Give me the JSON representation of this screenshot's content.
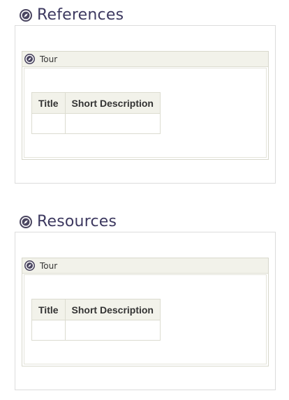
{
  "sections": [
    {
      "title": "References",
      "icon": "compass-icon",
      "panel": {
        "title": "Tour",
        "icon": "compass-icon",
        "table": {
          "columns": [
            "Title",
            "Short Description"
          ],
          "rows": [
            [
              "",
              ""
            ]
          ]
        }
      }
    },
    {
      "title": "Resources",
      "icon": "compass-icon",
      "panel": {
        "title": "Tour",
        "icon": "compass-icon",
        "table": {
          "columns": [
            "Title",
            "Short Description"
          ],
          "rows": [
            [
              "",
              ""
            ]
          ]
        }
      }
    }
  ],
  "colors": {
    "heading": "#3d3960",
    "icon": "#4a4560",
    "panel_header_bg": "#f2f2ea",
    "border": "#dcdcd0"
  }
}
